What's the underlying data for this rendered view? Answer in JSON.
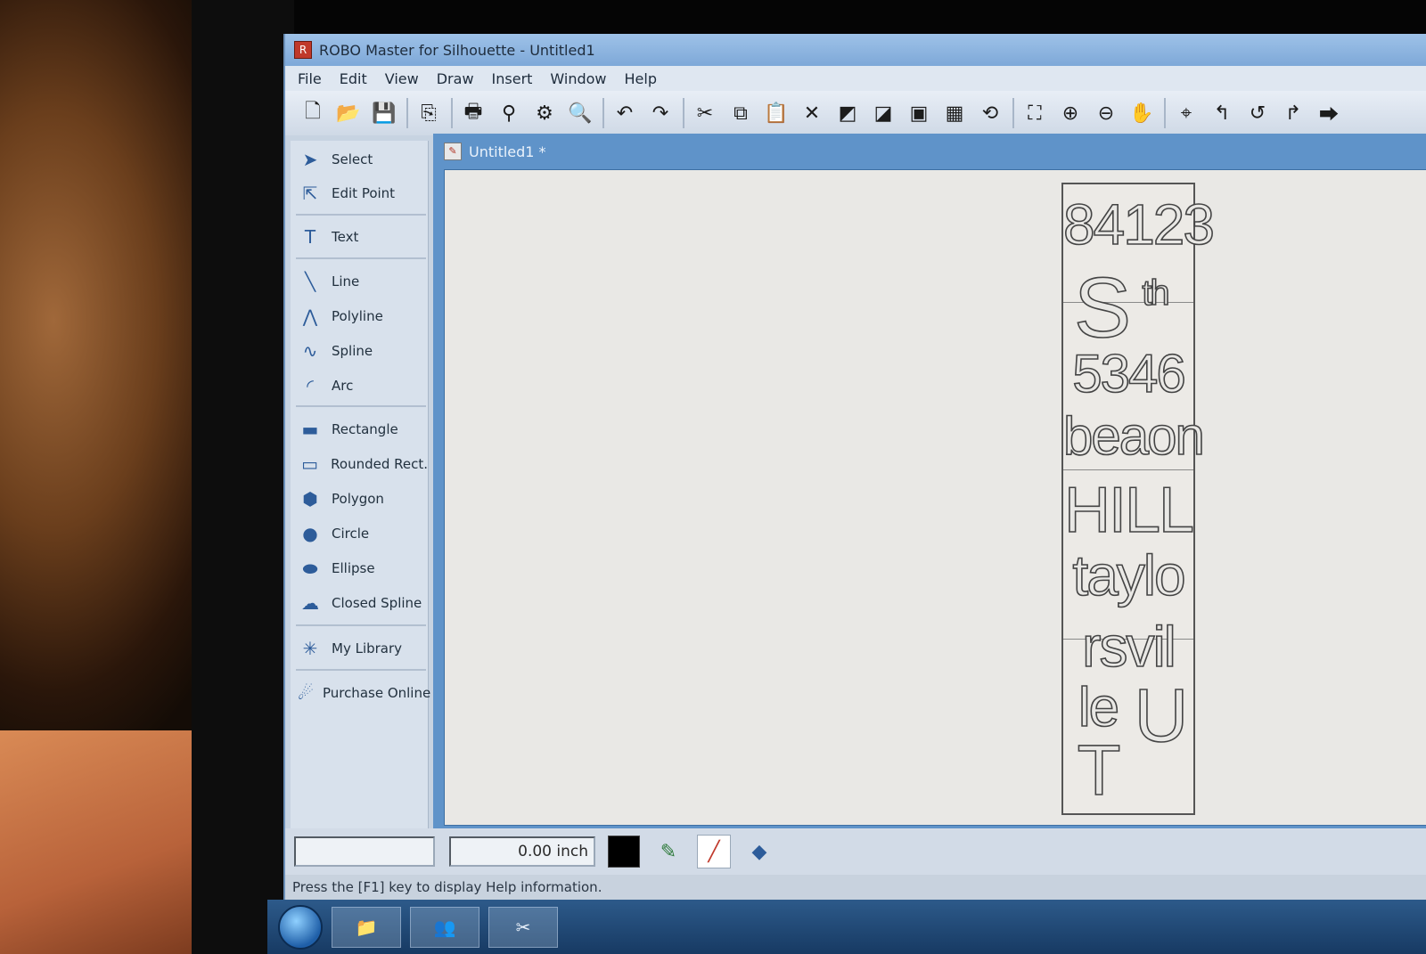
{
  "window": {
    "title": "ROBO Master for Silhouette - Untitled1"
  },
  "menu": [
    "File",
    "Edit",
    "View",
    "Draw",
    "Insert",
    "Window",
    "Help"
  ],
  "toolbar": [
    {
      "name": "new-doc-icon",
      "glyph": "🗋"
    },
    {
      "name": "open-icon",
      "glyph": "📂"
    },
    {
      "name": "save-icon",
      "glyph": "💾"
    },
    {
      "name": "sep"
    },
    {
      "name": "send-to-cutter-icon",
      "glyph": "⎘"
    },
    {
      "name": "sep"
    },
    {
      "name": "print-icon",
      "glyph": "🖶"
    },
    {
      "name": "cut-icon",
      "glyph": "⚲"
    },
    {
      "name": "print-setup-icon",
      "glyph": "⚙"
    },
    {
      "name": "print-preview-icon",
      "glyph": "🔍"
    },
    {
      "name": "sep"
    },
    {
      "name": "undo-icon",
      "glyph": "↶"
    },
    {
      "name": "redo-icon",
      "glyph": "↷"
    },
    {
      "name": "sep"
    },
    {
      "name": "scissors-icon",
      "glyph": "✂"
    },
    {
      "name": "copy-icon",
      "glyph": "⧉"
    },
    {
      "name": "paste-icon",
      "glyph": "📋"
    },
    {
      "name": "delete-icon",
      "glyph": "✕"
    },
    {
      "name": "bring-front-icon",
      "glyph": "◩"
    },
    {
      "name": "send-back-icon",
      "glyph": "◪"
    },
    {
      "name": "group-icon",
      "glyph": "▣"
    },
    {
      "name": "ungroup-icon",
      "glyph": "▦"
    },
    {
      "name": "rotate-icon",
      "glyph": "⟲"
    },
    {
      "name": "sep"
    },
    {
      "name": "fit-page-icon",
      "glyph": "⛶"
    },
    {
      "name": "zoom-in-icon",
      "glyph": "⊕"
    },
    {
      "name": "zoom-out-icon",
      "glyph": "⊖"
    },
    {
      "name": "pan-hand-icon",
      "glyph": "✋"
    },
    {
      "name": "sep"
    },
    {
      "name": "registration-icon",
      "glyph": "⌖"
    },
    {
      "name": "move-left-icon",
      "glyph": "↰"
    },
    {
      "name": "rotate-left-icon",
      "glyph": "↺"
    },
    {
      "name": "move-right-icon",
      "glyph": "↱"
    },
    {
      "name": "feed-icon",
      "glyph": "⮕"
    }
  ],
  "tools": [
    {
      "name": "select",
      "label": "Select",
      "icon": "arrow-icon",
      "glyph": "➤"
    },
    {
      "name": "edit-point",
      "label": "Edit Point",
      "icon": "edit-point-icon",
      "glyph": "⇱"
    },
    {
      "name": "text",
      "label": "Text",
      "icon": "text-t-icon",
      "glyph": "T"
    },
    {
      "name": "line",
      "label": "Line",
      "icon": "line-icon",
      "glyph": "╲"
    },
    {
      "name": "polyline",
      "label": "Polyline",
      "icon": "polyline-icon",
      "glyph": "⋀"
    },
    {
      "name": "spline",
      "label": "Spline",
      "icon": "spline-icon",
      "glyph": "∿"
    },
    {
      "name": "arc",
      "label": "Arc",
      "icon": "arc-icon",
      "glyph": "◜"
    },
    {
      "name": "rectangle",
      "label": "Rectangle",
      "icon": "rectangle-icon",
      "glyph": "▬"
    },
    {
      "name": "rounded-rect",
      "label": "Rounded Rect.",
      "icon": "rounded-rect-icon",
      "glyph": "▭"
    },
    {
      "name": "polygon",
      "label": "Polygon",
      "icon": "polygon-icon",
      "glyph": "⬢"
    },
    {
      "name": "circle",
      "label": "Circle",
      "icon": "circle-icon",
      "glyph": "●"
    },
    {
      "name": "ellipse",
      "label": "Ellipse",
      "icon": "ellipse-icon",
      "glyph": "⬬"
    },
    {
      "name": "closed-spline",
      "label": "Closed Spline",
      "icon": "closed-spline-icon",
      "glyph": "☁"
    },
    {
      "name": "my-library",
      "label": "My Library",
      "icon": "library-star-icon",
      "glyph": "✳"
    },
    {
      "name": "purchase-online",
      "label": "Purchase Online",
      "icon": "purchase-icon",
      "glyph": "☄"
    }
  ],
  "document": {
    "tab_label": "Untitled1 *",
    "design_text": [
      "84123",
      "S",
      "th",
      "5346",
      "beaon",
      "HILL",
      "taylo",
      "rsvil",
      "le",
      "U",
      "T"
    ]
  },
  "status": {
    "unit_value": "0.00 inch",
    "help_text": "Press the [F1] key to display Help information."
  },
  "taskbar": {
    "buttons": [
      {
        "name": "explorer-task-icon",
        "glyph": "📁"
      },
      {
        "name": "users-task-icon",
        "glyph": "👥"
      },
      {
        "name": "quickcut-task-icon",
        "glyph": "✂"
      }
    ]
  }
}
